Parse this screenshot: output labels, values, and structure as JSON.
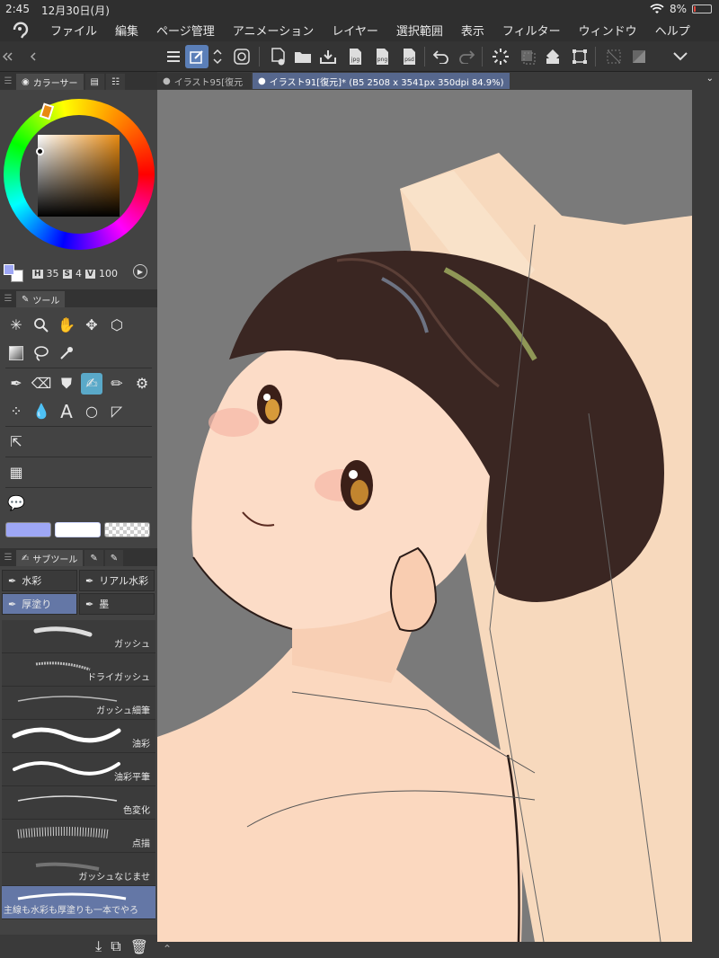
{
  "status": {
    "time": "2:45",
    "date": "12月30日(月)",
    "battery": "8%"
  },
  "menu": {
    "items": [
      "ファイル",
      "編集",
      "ページ管理",
      "アニメーション",
      "レイヤー",
      "選択範囲",
      "表示",
      "フィルター",
      "ウィンドウ",
      "ヘルプ"
    ]
  },
  "toolbar": {
    "export_labels": {
      "jpg": "jpg",
      "png": "png",
      "psd": "psd"
    }
  },
  "panels": {
    "color": {
      "tab_label": "カラーサー",
      "h_key": "H",
      "h_val": "35",
      "s_key": "S",
      "s_val": "4",
      "v_key": "V",
      "v_val": "100",
      "main_color": "#9ea7f5",
      "sub_color": "#ffffff"
    },
    "tools": {
      "tab_label": "ツール"
    },
    "subtool": {
      "tab_label": "サブツール",
      "groups": [
        "水彩",
        "リアル水彩",
        "厚塗り",
        "墨"
      ],
      "brushes": [
        "ガッシュ",
        "ドライガッシュ",
        "ガッシュ細筆",
        "油彩",
        "油彩平筆",
        "色変化",
        "点描",
        "ガッシュなじませ",
        "主線も水彩も厚塗りも一本でやろ"
      ]
    }
  },
  "documents": {
    "tabs": [
      "イラスト95[復元",
      "イラスト91[復元]* (B5 2508 x 3541px 350dpi 84.9%)"
    ]
  },
  "colors": {
    "accent": "#5b7fb8",
    "subtool_active": "#6477a6",
    "tool_active": "#5aa9c9"
  }
}
